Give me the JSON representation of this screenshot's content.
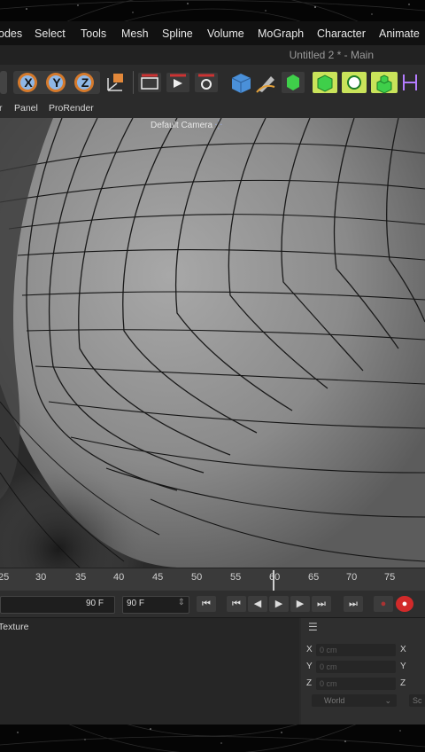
{
  "menu": {
    "items": [
      "odes",
      "Select",
      "Tools",
      "Mesh",
      "Spline",
      "Volume",
      "MoGraph",
      "Character",
      "Animate"
    ]
  },
  "window": {
    "title": "Untitled 2 * - Main"
  },
  "toolbar": {
    "x_label": "X",
    "y_label": "Y",
    "z_label": "Z"
  },
  "subbar": {
    "items": [
      "r",
      "Panel",
      "ProRender"
    ]
  },
  "viewport": {
    "camera_label": "Default Camera"
  },
  "timeline": {
    "ticks": [
      "25",
      "30",
      "35",
      "40",
      "45",
      "50",
      "55",
      "60",
      "65",
      "70",
      "75"
    ]
  },
  "transport": {
    "end_frame": "90 F",
    "end_frame_field": "90 F"
  },
  "material_panel": {
    "tab": "Texture"
  },
  "coordinates": {
    "rows": [
      {
        "axis": "X",
        "value": "0 cm",
        "axis2": "X"
      },
      {
        "axis": "Y",
        "value": "0 cm",
        "axis2": "Y"
      },
      {
        "axis": "Z",
        "value": "0 cm",
        "axis2": "Z"
      }
    ],
    "mode": "World",
    "mode2": "Sc"
  },
  "colors": {
    "menubar_bg": "#111111",
    "panel_bg": "#2b2b2b",
    "record_red": "#d22a2a",
    "axis_orange": "#e2883a"
  }
}
